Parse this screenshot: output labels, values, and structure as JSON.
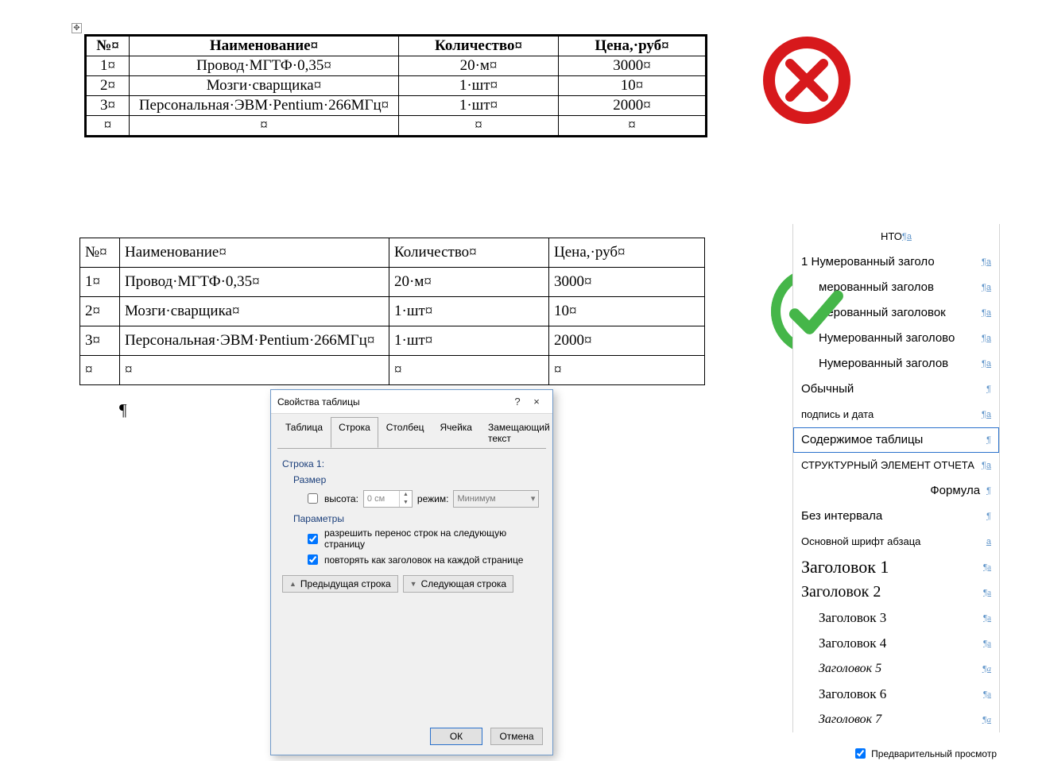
{
  "table1": {
    "header": [
      "№¤",
      "Наименование¤",
      "Количество¤",
      "Цена,·руб¤"
    ],
    "rows": [
      [
        "1¤",
        "Провод·МГТФ·0,35¤",
        "20·м¤",
        "3000¤"
      ],
      [
        "2¤",
        "Мозги·сварщика¤",
        "1·шт¤",
        "10¤"
      ],
      [
        "3¤",
        "Персональная·ЭВМ·Pentium·266МГц¤",
        "1·шт¤",
        "2000¤"
      ],
      [
        "¤",
        "¤",
        "¤",
        "¤"
      ]
    ]
  },
  "table2": {
    "header": [
      "№¤",
      "Наименование¤",
      "Количество¤",
      "Цена,·руб¤"
    ],
    "rows": [
      [
        "1¤",
        "Провод·МГТФ·0,35¤",
        "20·м¤",
        "3000¤"
      ],
      [
        "2¤",
        "Мозги·сварщика¤",
        "1·шт¤",
        "10¤"
      ],
      [
        "3¤",
        "Персональная·ЭВМ·Pentium·266МГц¤",
        "1·шт¤",
        "2000¤"
      ],
      [
        "¤",
        "¤",
        "¤",
        "¤"
      ]
    ]
  },
  "paragraph_mark": "¶",
  "dialog": {
    "title": "Свойства таблицы",
    "help": "?",
    "close": "×",
    "tabs": [
      "Таблица",
      "Строка",
      "Столбец",
      "Ячейка",
      "Замещающий текст"
    ],
    "active_tab": 1,
    "row_title": "Строка 1:",
    "group_size": "Размер",
    "chk_height": "высота:",
    "height_value": "0 см",
    "mode_label": "режим:",
    "mode_value": "Минимум",
    "group_params": "Параметры",
    "chk_wrap": "разрешить перенос строк на следующую страницу",
    "chk_repeat": "повторять как заголовок на каждой странице",
    "btn_prev": "Предыдущая строка",
    "btn_next": "Следующая строка",
    "btn_ok": "ОК",
    "btn_cancel": "Отмена"
  },
  "styles": [
    {
      "label": "НТО",
      "sym": "¶a",
      "cls": "center style-small"
    },
    {
      "label": "1  Нумерованный заголо",
      "sym": "¶a",
      "cls": ""
    },
    {
      "label": "мерованный заголов",
      "sym": "¶a",
      "cls": "",
      "pad": true
    },
    {
      "label": "мерованный заголовок",
      "sym": "¶a",
      "cls": "",
      "pad": true
    },
    {
      "label": "Нумерованный заголово",
      "sym": "¶a",
      "cls": "",
      "pad": true
    },
    {
      "label": "Нумерованный заголов",
      "sym": "¶a",
      "cls": "",
      "pad": true
    },
    {
      "label": "Обычный",
      "sym": "¶",
      "cls": ""
    },
    {
      "label": "подпись и дата",
      "sym": "¶a",
      "cls": "style-small"
    },
    {
      "label": "Содержимое таблицы",
      "sym": "¶",
      "cls": "",
      "selected": true
    },
    {
      "label": "СТРУКТУРНЫЙ ЭЛЕМЕНТ ОТЧЕТА",
      "sym": "¶a",
      "cls": "style-small"
    },
    {
      "label": "Формула",
      "sym": "¶",
      "cls": "",
      "align": "right"
    },
    {
      "label": "Без интервала",
      "sym": "¶",
      "cls": ""
    },
    {
      "label": "Основной шрифт абзаца",
      "sym": "a",
      "cls": "style-small"
    },
    {
      "label": "Заголовок 1",
      "sym": "¶a",
      "cls": "style-h1"
    },
    {
      "label": "Заголовок 2",
      "sym": "¶a",
      "cls": "style-h2"
    },
    {
      "label": "Заголовок 3",
      "sym": "¶a",
      "cls": "style-h34",
      "pad": true
    },
    {
      "label": "Заголовок 4",
      "sym": "¶a",
      "cls": "style-h34",
      "pad": true
    },
    {
      "label": "Заголовок 5",
      "sym": "¶a",
      "cls": "style-h5",
      "pad": true
    },
    {
      "label": "Заголовок 6",
      "sym": "¶a",
      "cls": "style-h34",
      "pad": true
    },
    {
      "label": "Заголовок 7",
      "sym": "¶a",
      "cls": "style-h5",
      "pad": true
    }
  ],
  "preview_label": "Предварительный просмотр"
}
